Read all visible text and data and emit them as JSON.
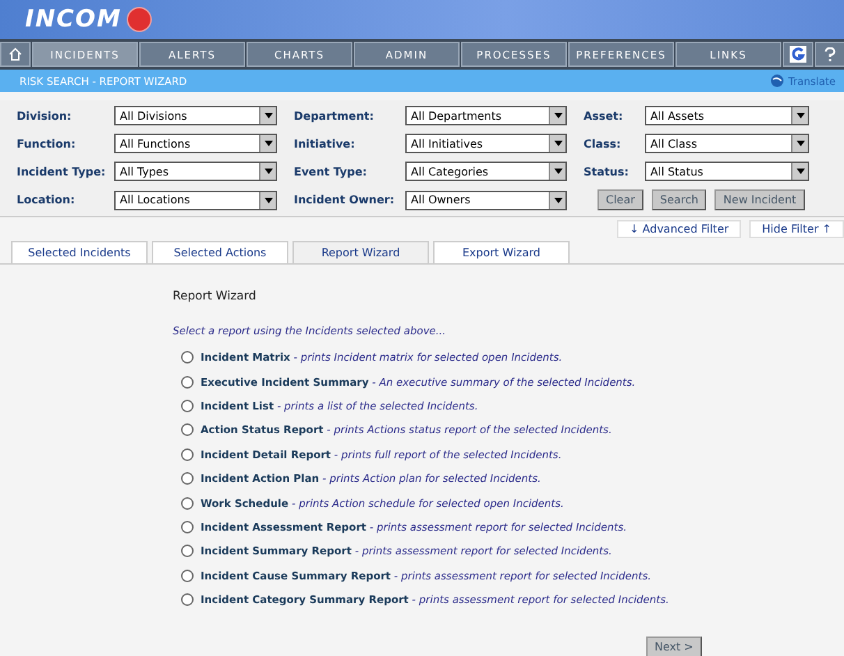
{
  "header": {
    "logo": "INCOM"
  },
  "nav": [
    {
      "label": "INCIDENTS",
      "selected": true
    },
    {
      "label": "ALERTS",
      "selected": false
    },
    {
      "label": "CHARTS",
      "selected": false
    },
    {
      "label": "ADMIN",
      "selected": false
    },
    {
      "label": "PROCESSES",
      "selected": false
    },
    {
      "label": "PREFERENCES",
      "selected": false
    },
    {
      "label": "LINKS",
      "selected": false
    }
  ],
  "subheader": {
    "title": "RISK SEARCH - REPORT WIZARD",
    "translate": "Translate"
  },
  "filters": [
    {
      "label": "Division:",
      "value": "All Divisions"
    },
    {
      "label": "Department:",
      "value": "All Departments"
    },
    {
      "label": "Asset:",
      "value": "All Assets"
    },
    {
      "label": "Function:",
      "value": "All Functions"
    },
    {
      "label": "Initiative:",
      "value": "All Initiatives"
    },
    {
      "label": "Class:",
      "value": "All Class"
    },
    {
      "label": "Incident Type:",
      "value": "All Types"
    },
    {
      "label": "Event Type:",
      "value": "All Categories"
    },
    {
      "label": "Status:",
      "value": "All Status"
    },
    {
      "label": "Location:",
      "value": "All Locations"
    },
    {
      "label": "Incident Owner:",
      "value": "All Owners"
    }
  ],
  "filter_buttons": [
    "Clear",
    "Search",
    "New Incident"
  ],
  "filter_links": [
    {
      "label": "Advanced Filter",
      "arrow": "↓"
    },
    {
      "label": "Hide Filter",
      "arrow": "↑"
    }
  ],
  "tabs": [
    {
      "label": "Selected Incidents",
      "selected": false
    },
    {
      "label": "Selected Actions",
      "selected": false
    },
    {
      "label": "Report Wizard",
      "selected": true
    },
    {
      "label": "Export Wizard",
      "selected": false
    }
  ],
  "wizard": {
    "title": "Report Wizard",
    "instruction": "Select a report using the Incidents selected above...",
    "reports": [
      {
        "name": "Incident Matrix",
        "description": "prints Incident matrix for selected open Incidents.",
        "selected": false
      },
      {
        "name": "Executive Incident Summary",
        "description": "An executive summary of the selected Incidents.",
        "selected": false
      },
      {
        "name": "Incident List",
        "description": "prints a list of the selected Incidents.",
        "selected": false
      },
      {
        "name": "Action Status Report",
        "description": "prints Actions status report of the selected Incidents.",
        "selected": false
      },
      {
        "name": "Incident Detail Report",
        "description": "prints full report of the selected Incidents.",
        "selected": false
      },
      {
        "name": "Incident Action Plan",
        "description": "prints Action plan for selected Incidents.",
        "selected": false
      },
      {
        "name": "Work Schedule",
        "description": "prints Action schedule for selected open Incidents.",
        "selected": false
      },
      {
        "name": "Incident Assessment Report",
        "description": "prints assessment report for selected Incidents.",
        "selected": false
      },
      {
        "name": "Incident Summary Report",
        "description": "prints assessment report for selected Incidents.",
        "selected": false
      },
      {
        "name": "Incident Cause Summary Report",
        "description": "prints assessment report for selected Incidents.",
        "selected": false
      },
      {
        "name": "Incident Category Summary Report",
        "description": "prints assessment report for selected Incidents.",
        "selected": false
      }
    ],
    "separator": "-",
    "next": "Next >"
  }
}
